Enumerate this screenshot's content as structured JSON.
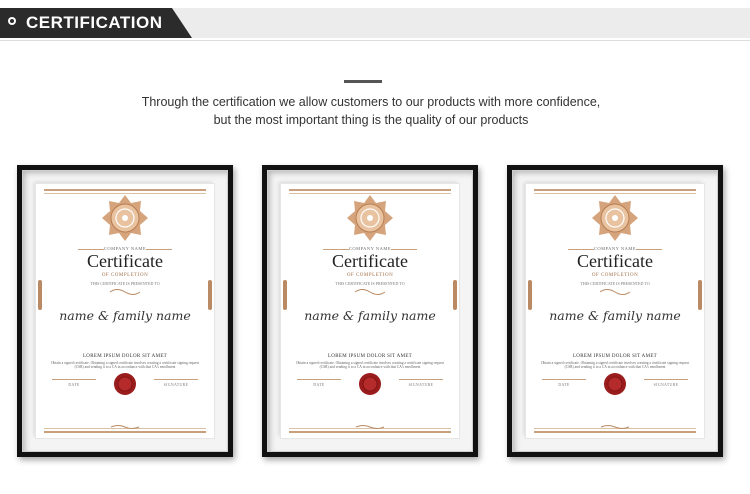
{
  "header": {
    "title": "CERTIFICATION",
    "icon": "circle-outline-icon"
  },
  "intro": {
    "line1": "Through the certification we allow customers to our products with more confidence,",
    "line2": "but the most important thing is the quality of our products"
  },
  "colors": {
    "header_dark": "#2b2b2b",
    "gold": "#c9a07c",
    "seal_red": "#9b1c1c",
    "frame": "#111111"
  },
  "certificates": [
    {
      "company": "COMPANY NAME",
      "title": "Certificate",
      "subtitle": "OF COMPLETION",
      "presented": "THIS CERTIFICATE IS PRESENTED TO",
      "recipient": "name & family name",
      "lorem_title": "LOREM IPSUM DOLOR SIT AMET",
      "lorem_body": "Obtain a signed certificate. Obtaining a signed certificate involves creating a certificate signing request (CSR) and sending it to a CA in accordance with that CA's enrollment",
      "date_label": "DATE",
      "signature_label": "SIGNATURE"
    },
    {
      "company": "COMPANY NAME",
      "title": "Certificate",
      "subtitle": "OF COMPLETION",
      "presented": "THIS CERTIFICATE IS PRESENTED TO",
      "recipient": "name & family name",
      "lorem_title": "LOREM IPSUM DOLOR SIT AMET",
      "lorem_body": "Obtain a signed certificate. Obtaining a signed certificate involves creating a certificate signing request (CSR) and sending it to a CA in accordance with that CA's enrollment",
      "date_label": "DATE",
      "signature_label": "SIGNATURE"
    },
    {
      "company": "COMPANY NAME",
      "title": "Certificate",
      "subtitle": "OF COMPLETION",
      "presented": "THIS CERTIFICATE IS PRESENTED TO",
      "recipient": "name & family name",
      "lorem_title": "LOREM IPSUM DOLOR SIT AMET",
      "lorem_body": "Obtain a signed certificate. Obtaining a signed certificate involves creating a certificate signing request (CSR) and sending it to a CA in accordance with that CA's enrollment",
      "date_label": "DATE",
      "signature_label": "SIGNATURE"
    }
  ]
}
